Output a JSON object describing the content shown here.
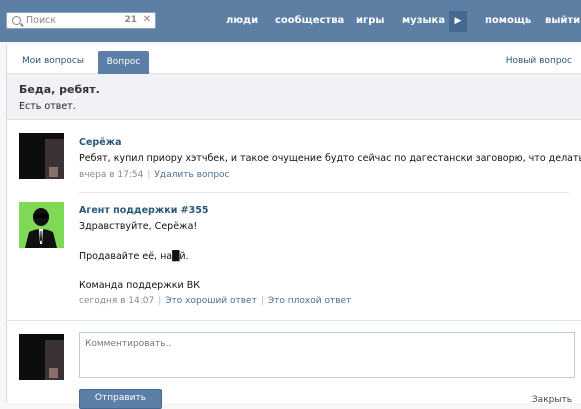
{
  "header": {
    "search": {
      "placeholder": "Поиск",
      "count": "21",
      "close": "✕"
    },
    "nav": [
      "люди",
      "сообщества",
      "игры",
      "музыка",
      "помощь",
      "выйти"
    ],
    "more_arrow": "▶"
  },
  "tabs": {
    "mine": "Мои вопросы",
    "active": "Вопрос",
    "new_question": "Новый вопрос"
  },
  "question": {
    "title": "Беда, ребят.",
    "status": "Есть ответ."
  },
  "posts": [
    {
      "author": "Серёжа",
      "text": "Ребят, купил приору хэтчбек, и такое очущение будто сейчас по дагестански заговорю, что делать?",
      "time": "вчера в 17:54",
      "actions": [
        "Удалить вопрос"
      ]
    },
    {
      "author": "Агент поддержки #355",
      "greeting": "Здравствуйте, Серёжа!",
      "answer": "Продавайте её, на█й.",
      "signature": "Команда поддержки ВК",
      "time": "сегодня в 14:07",
      "actions": [
        "Это хороший ответ",
        "Это плохой ответ"
      ]
    }
  ],
  "comment": {
    "placeholder": "Комментировать..",
    "submit_label": "Отправить",
    "footer_link": "Закрыть"
  },
  "colors": {
    "header": "#5d7fa3",
    "accent": "#5b7fa6",
    "link": "#2b587a",
    "agent_avatar": "#7ed957"
  },
  "icons": {
    "search": "search-icon",
    "agent": "agent-silhouette-icon"
  }
}
